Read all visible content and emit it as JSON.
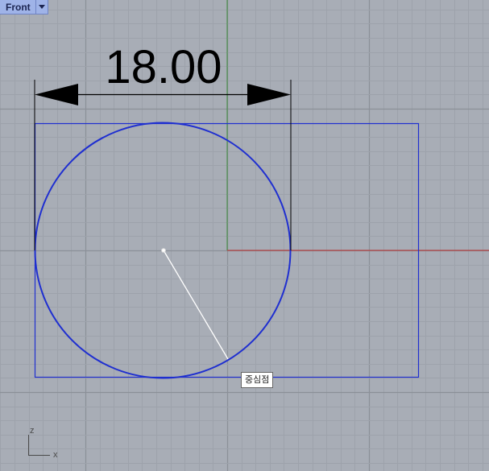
{
  "viewport": {
    "name": "Front"
  },
  "dimension": {
    "value": "18.00"
  },
  "snap_tooltip": "중심점",
  "axis_widget": {
    "vertical_label": "z",
    "horizontal_label": "x"
  },
  "colors": {
    "background": "#a8adb6",
    "grid_minor": "#9da2ab",
    "grid_major": "#8b9098",
    "x_axis": "#b04040",
    "z_axis": "#3a8a3a",
    "curves": "#1f2fd0",
    "dimension": "#000000",
    "rubber_band": "#ffffff"
  },
  "icons": {
    "viewport_menu": "triangle-down-icon"
  }
}
